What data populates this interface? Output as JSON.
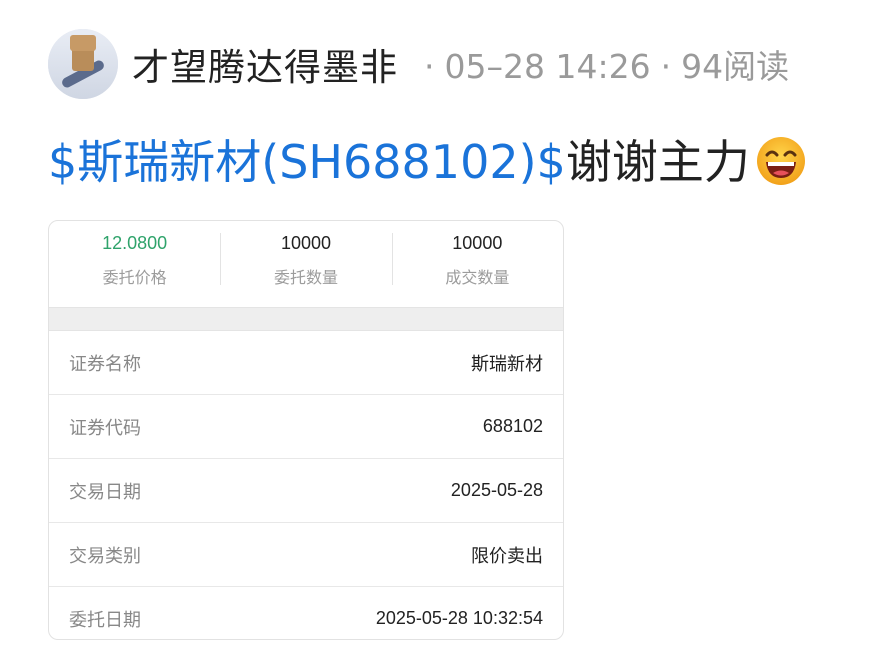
{
  "post": {
    "username": "才望腾达得墨非",
    "date": "05–28 14:26",
    "reads": "94阅读",
    "stock_tag": "$斯瑞新材(SH688102)$",
    "text": "谢谢主力",
    "emoji": "laughing-emoji"
  },
  "order": {
    "stats": [
      {
        "value": "12.0800",
        "label": "委托价格"
      },
      {
        "value": "10000",
        "label": "委托数量"
      },
      {
        "value": "10000",
        "label": "成交数量"
      }
    ],
    "rows": [
      {
        "label": "证券名称",
        "value": "斯瑞新材"
      },
      {
        "label": "证券代码",
        "value": "688102"
      },
      {
        "label": "交易日期",
        "value": "2025-05-28"
      },
      {
        "label": "交易类别",
        "value": "限价卖出"
      },
      {
        "label": "委托日期",
        "value": "2025-05-28 10:32:54"
      }
    ]
  },
  "colors": {
    "stock_link": "#1a73d9",
    "price_green": "#2fa36b",
    "meta_gray": "#9a9a9a"
  }
}
